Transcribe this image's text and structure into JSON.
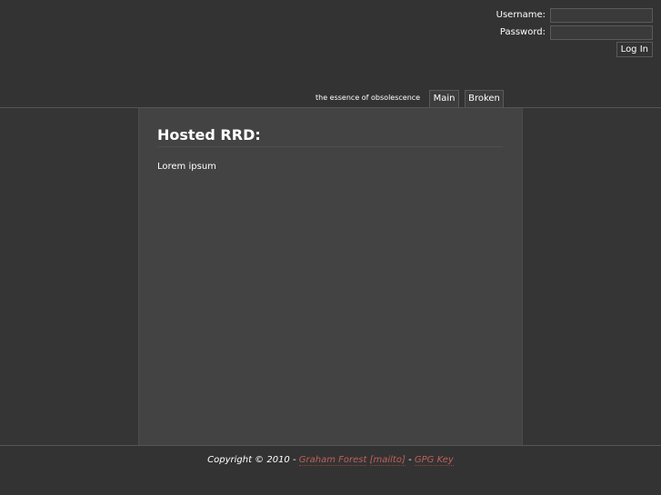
{
  "login": {
    "username_label": "Username:",
    "password_label": "Password:",
    "username_value": "",
    "password_value": "",
    "login_button": "Log In"
  },
  "nav": {
    "tagline": "the essence of obsolescence",
    "tabs": [
      {
        "label": "Main"
      },
      {
        "label": "Broken"
      }
    ]
  },
  "main": {
    "title": "Hosted RRD:",
    "body": "Lorem ipsum"
  },
  "footer": {
    "copyright": "Copyright © 2010 -",
    "author_link": "Graham Forest",
    "mailto_link": "[mailto]",
    "separator": "-",
    "gpg_link": "GPG Key"
  },
  "colors": {
    "background": "#353535",
    "content_bg": "#434343",
    "link": "#c0605a"
  }
}
